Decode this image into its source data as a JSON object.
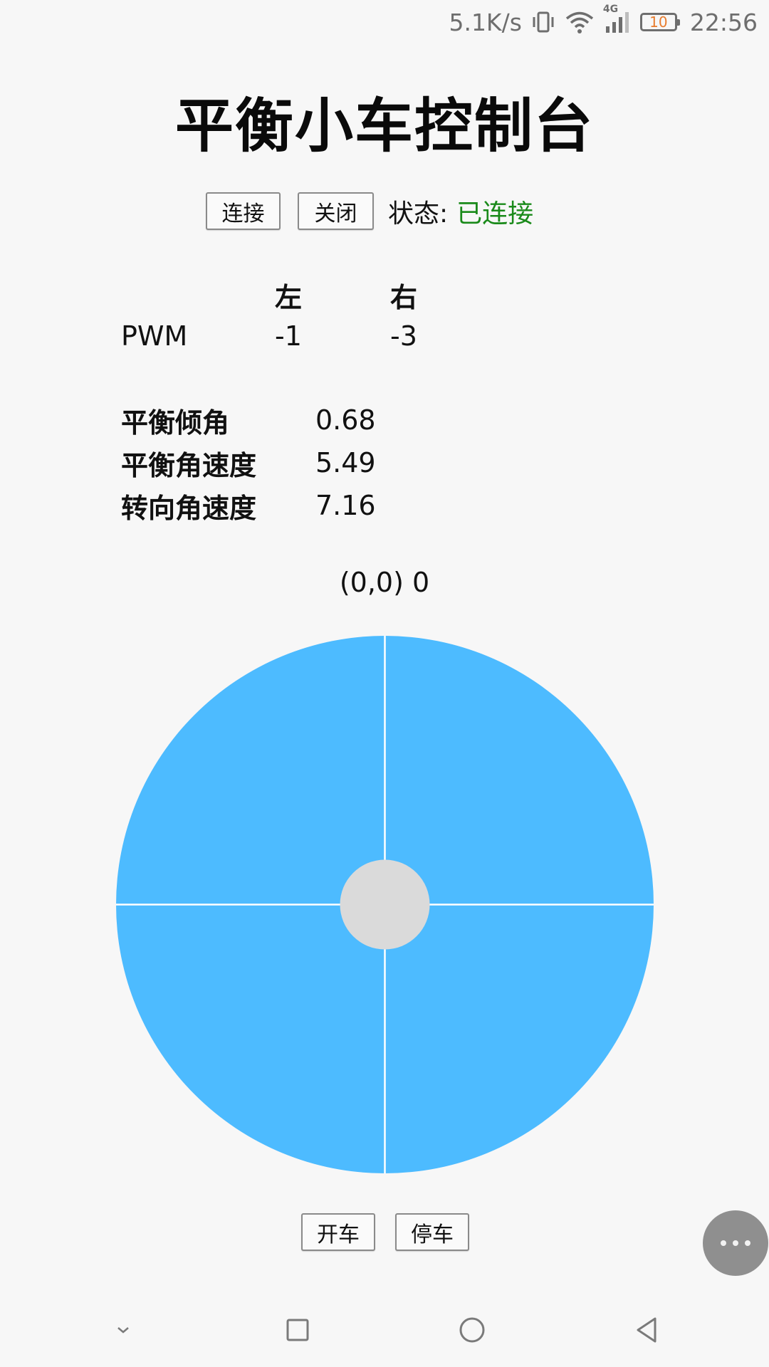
{
  "status_bar": {
    "speed": "5.1K/s",
    "network": "4G",
    "battery": "10",
    "time": "22:56",
    "icons": [
      "vibrate-icon",
      "wifi-icon",
      "signal-icon",
      "battery-icon"
    ]
  },
  "title": "平衡小车控制台",
  "connection": {
    "connect_label": "连接",
    "close_label": "关闭",
    "status_label": "状态:",
    "status_value": "已连接",
    "status_color": "#1a8a1a"
  },
  "pwm": {
    "headers": [
      "",
      "左",
      "右"
    ],
    "row_label": "PWM",
    "left": "-1",
    "right": "-3"
  },
  "sensors": [
    {
      "label": "平衡倾角",
      "value": "0.68"
    },
    {
      "label": "平衡角速度",
      "value": "5.49"
    },
    {
      "label": "转向角速度",
      "value": "7.16"
    }
  ],
  "joystick": {
    "readout": "(0,0) 0",
    "pad_color": "#4dbbff",
    "knob_color": "#dadada"
  },
  "drive": {
    "start_label": "开车",
    "stop_label": "停车"
  },
  "fab": {
    "icon": "more-icon"
  },
  "nav_bar": {
    "icons": [
      "chevron-down-icon",
      "recent-apps-icon",
      "home-icon",
      "back-icon"
    ]
  }
}
